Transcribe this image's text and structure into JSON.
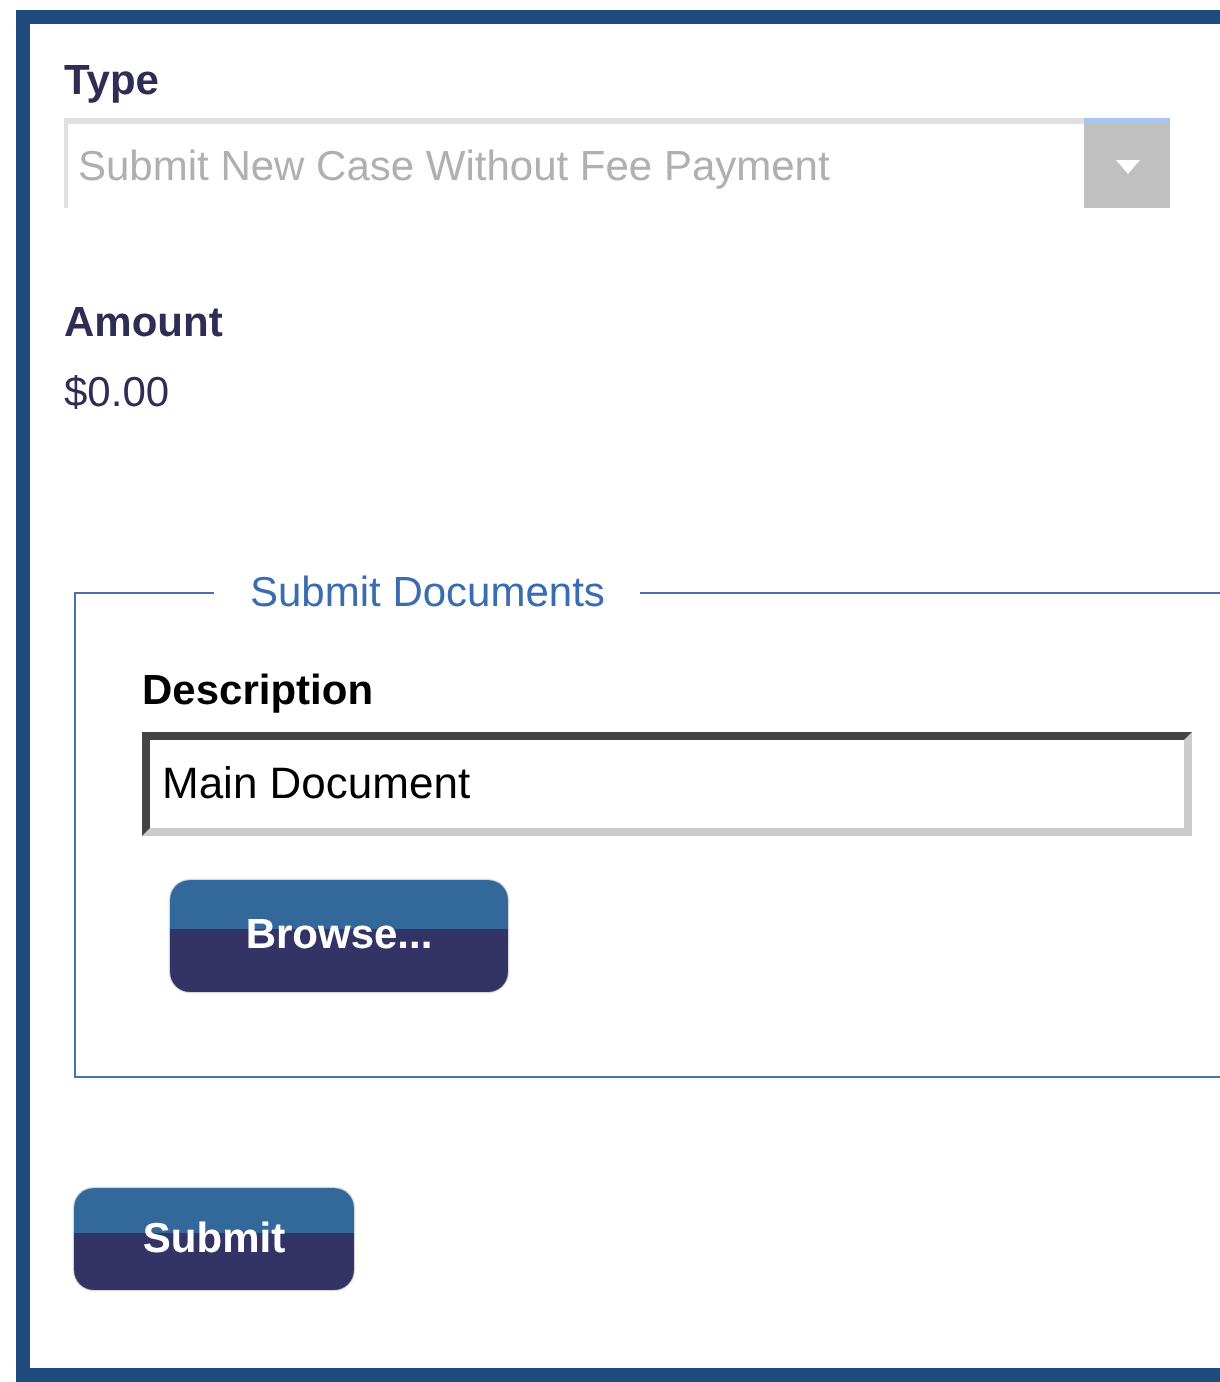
{
  "type_field": {
    "label": "Type",
    "value": "Submit New Case Without Fee Payment",
    "disabled": true
  },
  "amount": {
    "label": "Amount",
    "value": "$0.00"
  },
  "documents": {
    "legend": "Submit Documents",
    "description_label": "Description",
    "description_value": "Main Document",
    "browse_button": "Browse..."
  },
  "submit_button": "Submit"
}
